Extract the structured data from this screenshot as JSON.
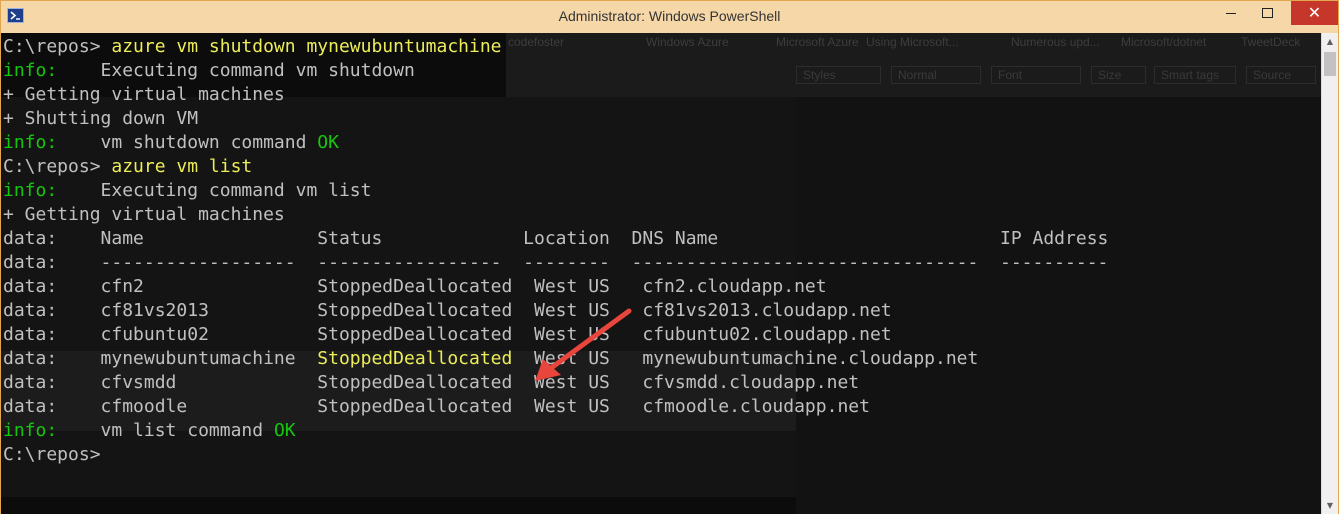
{
  "window": {
    "title": "Administrator: Windows PowerShell",
    "buttons": {
      "minimize": "minimize",
      "maximize": "maximize",
      "close": "✕"
    }
  },
  "background_window": {
    "tabs": [
      "codefoster",
      "Windows Azure",
      "Microsoft Azure",
      "Using Microsoft...",
      "Numerous upd...",
      "Microsoft/dotnet",
      "TweetDeck"
    ],
    "toolbar_fields": [
      "Styles",
      "Normal",
      "Font",
      "Size",
      "Smart tags",
      "Source"
    ]
  },
  "terminal": {
    "lines": [
      [
        {
          "t": "C:\\repos> ",
          "c": "white"
        },
        {
          "t": "azure vm shutdown mynewubuntumachine",
          "c": "yellow"
        }
      ],
      [
        {
          "t": "info:",
          "c": "green"
        },
        {
          "t": "    Executing command ",
          "c": "white"
        },
        {
          "t": "vm shutdown",
          "c": "white"
        }
      ],
      [
        {
          "t": "+ Getting virtual machines",
          "c": "white"
        }
      ],
      [
        {
          "t": "+ Shutting down VM",
          "c": "white"
        }
      ],
      [
        {
          "t": "info:",
          "c": "green"
        },
        {
          "t": "    vm shutdown command ",
          "c": "white"
        },
        {
          "t": "OK",
          "c": "green"
        }
      ],
      [
        {
          "t": "C:\\repos> ",
          "c": "white"
        },
        {
          "t": "azure vm list",
          "c": "yellow"
        }
      ],
      [
        {
          "t": "info:",
          "c": "green"
        },
        {
          "t": "    Executing command ",
          "c": "white"
        },
        {
          "t": "vm list",
          "c": "white"
        }
      ],
      [
        {
          "t": "+ Getting virtual machines",
          "c": "white"
        }
      ],
      [
        {
          "t": "data:    Name                Status             Location  DNS Name                          IP Address",
          "c": "white"
        }
      ],
      [
        {
          "t": "data:    ------------------  -----------------  --------  --------------------------------  ----------",
          "c": "white"
        }
      ],
      [
        {
          "t": "data:    cfn2                StoppedDeallocated  West US   cfn2.cloudapp.net",
          "c": "white"
        }
      ],
      [
        {
          "t": "data:    cf81vs2013          StoppedDeallocated  West US   cf81vs2013.cloudapp.net",
          "c": "white"
        }
      ],
      [
        {
          "t": "data:    cfubuntu02          StoppedDeallocated  West US   cfubuntu02.cloudapp.net",
          "c": "white"
        }
      ],
      [
        {
          "t": "data:    mynewubuntumachine  ",
          "c": "white"
        },
        {
          "t": "StoppedDeallocated",
          "c": "yellow"
        },
        {
          "t": "  West US   mynewubuntumachine.cloudapp.net",
          "c": "white"
        }
      ],
      [
        {
          "t": "data:    cfvsmdd             StoppedDeallocated  West US   cfvsmdd.cloudapp.net",
          "c": "white"
        }
      ],
      [
        {
          "t": "data:    cfmoodle            StoppedDeallocated  West US   cfmoodle.cloudapp.net",
          "c": "white"
        }
      ],
      [
        {
          "t": "info:",
          "c": "green"
        },
        {
          "t": "    vm list command ",
          "c": "white"
        },
        {
          "t": "OK",
          "c": "green"
        }
      ],
      [
        {
          "t": "C:\\repos> ",
          "c": "white"
        }
      ]
    ]
  },
  "colors": {
    "titlebar": "#f6d7a8",
    "console_bg": "#0c0c0c",
    "prompt_cmd": "#eded5a",
    "ok_green": "#16c60c",
    "close_red": "#c7362a",
    "arrow_red": "#e8453c"
  },
  "scrollbar": {
    "up_icon": "▲",
    "down_icon": "▼"
  }
}
